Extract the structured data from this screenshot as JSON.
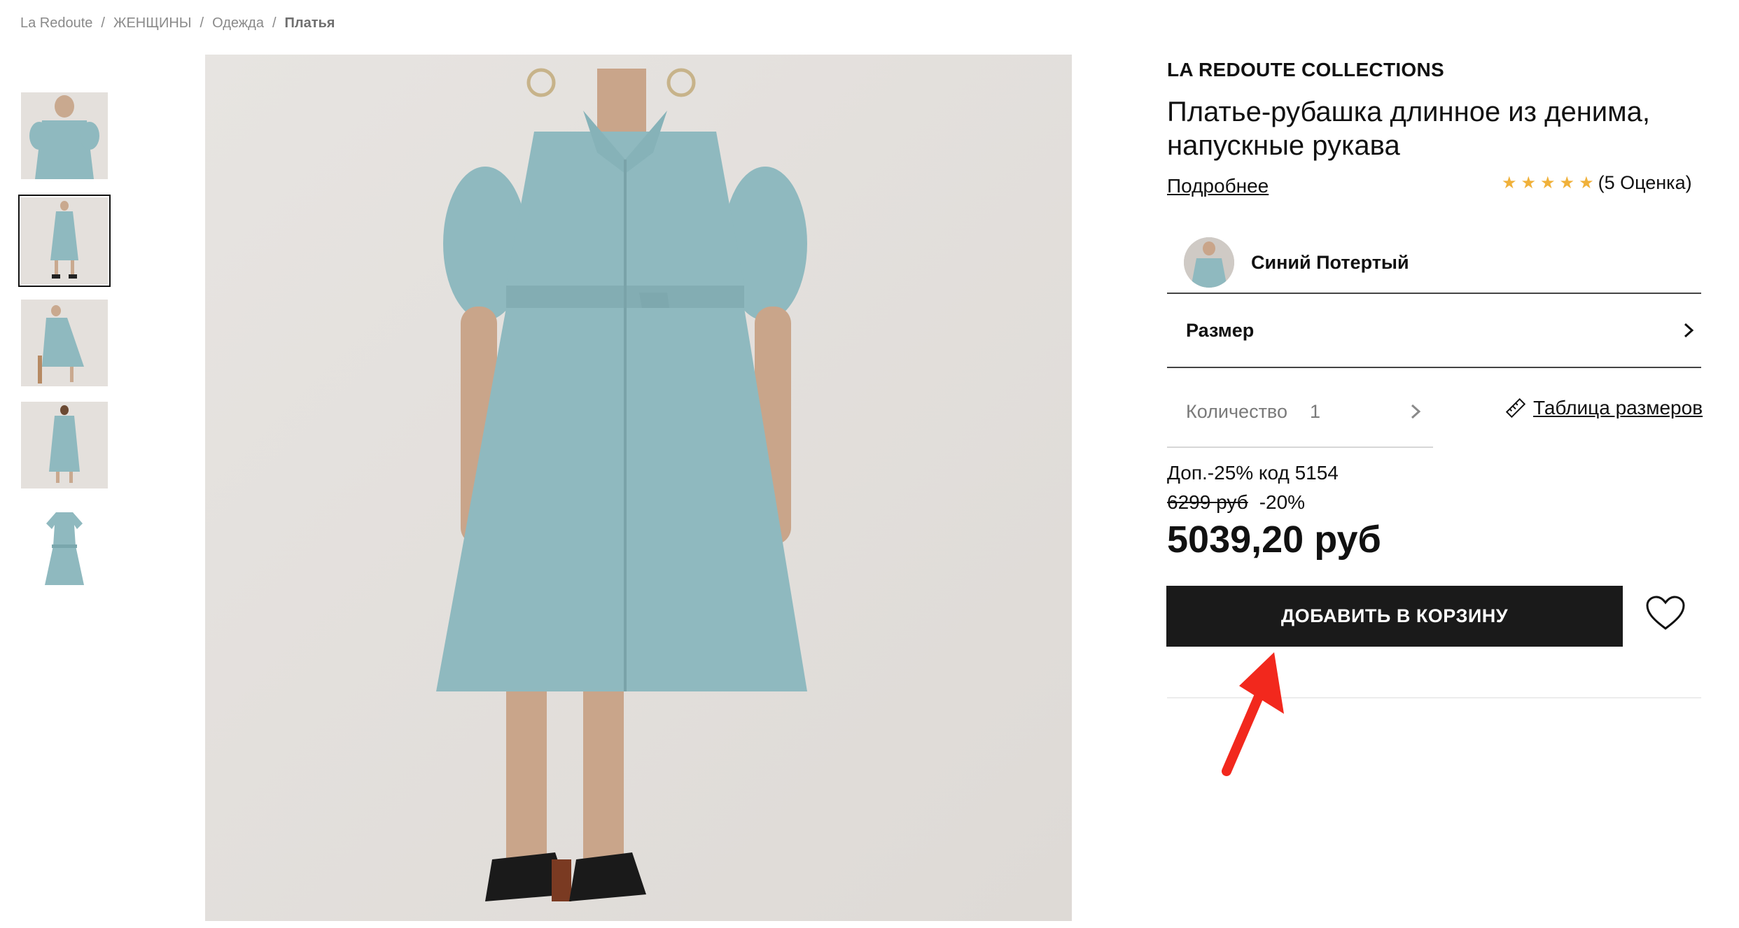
{
  "breadcrumb": {
    "items": [
      "La Redoute",
      "ЖЕНЩИНЫ",
      "Одежда"
    ],
    "current": "Платья",
    "separator": "/"
  },
  "gallery": {
    "thumbnails": [
      "thumb-1",
      "thumb-2",
      "thumb-3",
      "thumb-4",
      "thumb-5"
    ],
    "selected_index": 1
  },
  "product": {
    "brand": "LA REDOUTE COLLECTIONS",
    "title": "Платье-рубашка длинное из денима, напускные рукава",
    "more_link": "Подробнее",
    "rating": {
      "stars": 5,
      "max": 5,
      "label": "(5 Оценка)",
      "star_color": "#f0b13a"
    },
    "color": {
      "label": "Синий Потертый"
    },
    "size": {
      "label": "Размер"
    },
    "quantity": {
      "label": "Количество",
      "value": "1"
    },
    "size_table": {
      "label": "Таблица размеров"
    },
    "promo": "Доп.-25% код 5154",
    "old_price": "6299 руб",
    "discount": "-20%",
    "price": "5039,20 руб",
    "add_to_cart": "ДОБАВИТЬ В КОРЗИНУ"
  },
  "colors": {
    "button_bg": "#1a1a1a",
    "annotation_arrow": "#f2281d",
    "dress": "#8fb9bf"
  },
  "icons": [
    "chevron-right-icon",
    "ruler-icon",
    "heart-icon",
    "star-icon"
  ]
}
